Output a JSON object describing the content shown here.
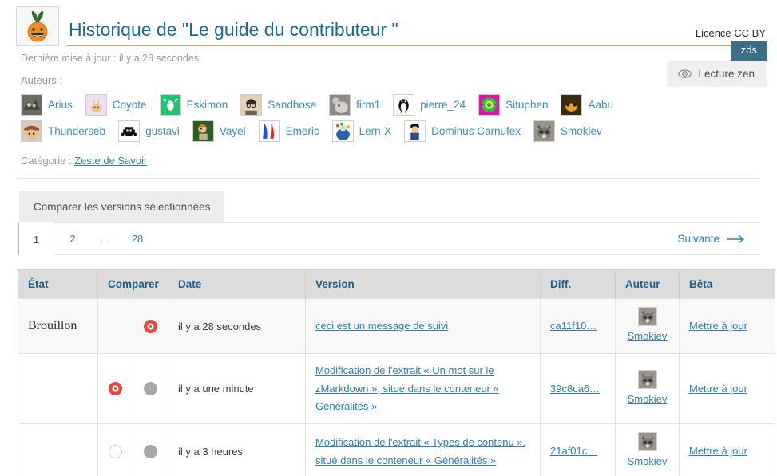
{
  "header": {
    "logo_alt": "zeste-de-savoir-logo",
    "title": "Historique de \"Le guide du contributeur \"",
    "licence": "Licence CC BY",
    "last_update": "Dernière mise à jour : il y a 28 secondes",
    "badge": "zds"
  },
  "authors": {
    "label": "Auteurs :",
    "zen_button": "Lecture zen",
    "zen_icon": "eye-icon",
    "row1": [
      {
        "name": "Arius",
        "avatar": "wolf"
      },
      {
        "name": "Coyote",
        "avatar": "bunny"
      },
      {
        "name": "Eskimon",
        "avatar": "moose"
      },
      {
        "name": "Sandhose",
        "avatar": "face-sketch"
      },
      {
        "name": "firm1",
        "avatar": "mouse"
      },
      {
        "name": "pierre_24",
        "avatar": "penguin"
      },
      {
        "name": "Situphen",
        "avatar": "sun-burst"
      },
      {
        "name": "Aabu",
        "avatar": "bee"
      }
    ],
    "row2": [
      {
        "name": "Thunderseb",
        "avatar": "cowboy"
      },
      {
        "name": "gustavi",
        "avatar": "space-invader"
      },
      {
        "name": "Vayel",
        "avatar": "rayman"
      },
      {
        "name": "Emeric",
        "avatar": "france-flag"
      },
      {
        "name": "Lern-X",
        "avatar": "painter"
      },
      {
        "name": "Dominus Carnufex",
        "avatar": "character"
      },
      {
        "name": "Smokiev",
        "avatar": "raccoon"
      }
    ]
  },
  "category": {
    "label": "Catégorie :",
    "value": "Zeste de Savoir"
  },
  "toolbar": {
    "compare_button": "Comparer les versions sélectionnées"
  },
  "pagination": {
    "pages": [
      "1",
      "2",
      "…",
      "28"
    ],
    "current": "1",
    "next_label": "Suivante",
    "next_icon": "arrow-right-icon"
  },
  "table": {
    "headers": [
      "État",
      "Comparer",
      "Date",
      "Version",
      "Diff.",
      "Auteur",
      "Bêta"
    ],
    "rows": [
      {
        "etat": "Brouillon",
        "cmp_left": "none",
        "cmp_right": "selected",
        "date": "il y a 28 secondes",
        "version": "ceci est un message de suivi",
        "diff": "ca11f10…",
        "auteur": "Smokiev",
        "auteur_avatar": "raccoon",
        "beta": "Mettre à jour"
      },
      {
        "etat": "",
        "cmp_left": "selected",
        "cmp_right": "disabled",
        "date": "il y a une minute",
        "version": "Modification de l'extrait « Un mot sur le zMarkdown », situé dans le conteneur « Généralités »",
        "diff": "39c8ca6…",
        "auteur": "Smokiev",
        "auteur_avatar": "raccoon",
        "beta": "Mettre à jour"
      },
      {
        "etat": "",
        "cmp_left": "off",
        "cmp_right": "disabled",
        "date": "il y a 3 heures",
        "version": "Modification de l'extrait « Types de contenu », situé dans le conteneur « Généralités »",
        "diff": "21af01c…",
        "auteur": "Smokiev",
        "auteur_avatar": "raccoon",
        "beta": "Mettre à jour"
      }
    ]
  },
  "colors": {
    "accent_orange": "#e8a33d",
    "link_blue": "#2f7fb5",
    "title_blue": "#1b6a94",
    "badge_bg": "#3c6e88",
    "radio_red": "#e8483f",
    "header_bg": "#dcdcdc"
  }
}
